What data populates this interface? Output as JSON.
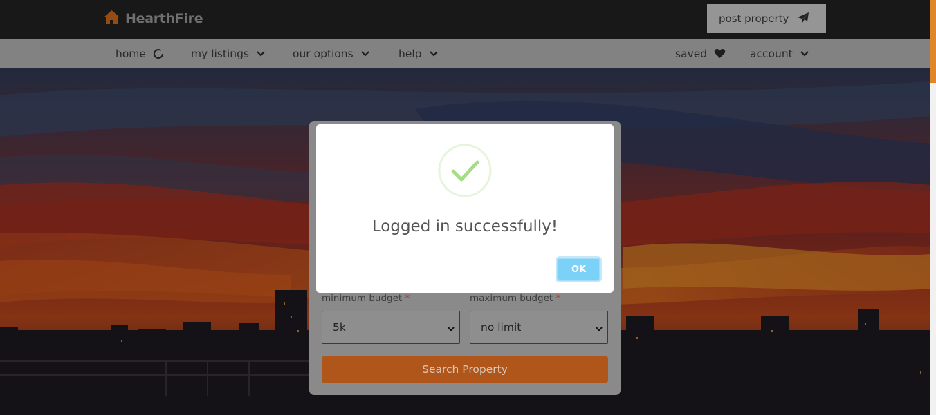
{
  "header": {
    "brand": "HearthFire",
    "brand_icon": "home-icon",
    "post_property_label": "post property",
    "post_property_icon": "paper-plane-icon"
  },
  "nav": {
    "items": [
      {
        "label": "home",
        "icon": "loading-circle-icon"
      },
      {
        "label": "my listings",
        "icon": "chevron-down-icon"
      },
      {
        "label": "our options",
        "icon": "chevron-down-icon"
      },
      {
        "label": "help",
        "icon": "chevron-down-icon"
      },
      {
        "label": "saved",
        "icon": "heart-icon"
      },
      {
        "label": "account",
        "icon": "chevron-down-icon"
      }
    ]
  },
  "search_form": {
    "min_budget_label": "minimum budget",
    "max_budget_label": "maximum budget",
    "required_marker": "*",
    "min_budget_value": "5k",
    "max_budget_value": "no limit",
    "search_button": "Search Property"
  },
  "modal": {
    "icon": "success-check-icon",
    "title": "Logged in successfully!",
    "ok_label": "OK"
  },
  "colors": {
    "brand_orange": "#d4661a",
    "search_button": "#b0561a",
    "ok_button": "#7cd1f9",
    "success_green": "#a5dc86"
  }
}
